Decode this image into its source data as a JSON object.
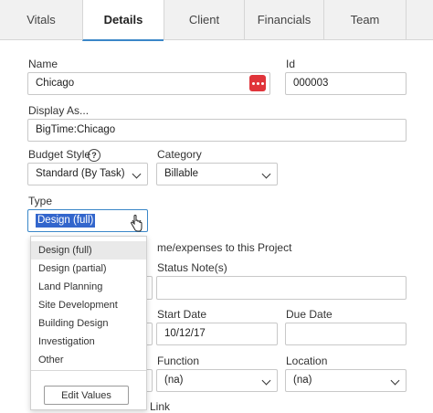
{
  "tabs": [
    {
      "label": "Vitals"
    },
    {
      "label": "Details"
    },
    {
      "label": "Client"
    },
    {
      "label": "Financials"
    },
    {
      "label": "Team"
    }
  ],
  "form": {
    "name_label": "Name",
    "name_value": "Chicago",
    "id_label": "Id",
    "id_value": "000003",
    "display_label": "Display As...",
    "display_value": "BigTime:Chicago",
    "budget_label": "Budget Style",
    "budget_value": "Standard (By Task)",
    "category_label": "Category",
    "category_value": "Billable",
    "type_label": "Type",
    "type_value": "Design (full)",
    "post_text": "me/expenses to this Project",
    "status_label": "Status Note(s)",
    "status_value": "",
    "start_label": "Start Date",
    "start_value": "10/12/17",
    "due_label": "Due Date",
    "due_value": "",
    "function_label": "Function",
    "function_value": "(na)",
    "location_label": "Location",
    "location_value": "(na)",
    "link_text": "Link"
  },
  "type_dropdown": {
    "options": [
      "Design (full)",
      "Design (partial)",
      "Land Planning",
      "Site Development",
      "Building Design",
      "Investigation",
      "Other"
    ],
    "hovered_index": 0,
    "edit_label": "Edit Values"
  },
  "colors": {
    "accent": "#3a87c8",
    "more_button": "#e0343a",
    "selection": "#3366cc"
  }
}
